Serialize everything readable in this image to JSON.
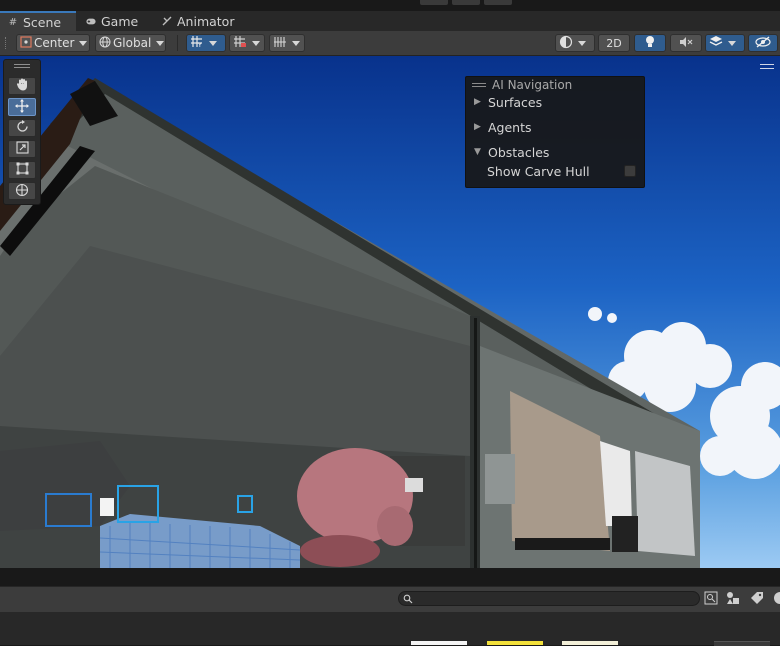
{
  "tabs": [
    {
      "label": "Scene",
      "icon": "hash-grid-icon"
    },
    {
      "label": "Game",
      "icon": "gamepad-icon"
    },
    {
      "label": "Animator",
      "icon": "animator-icon"
    }
  ],
  "toolbar": {
    "pivot_label": "Center",
    "space_label": "Global",
    "twod_label": "2D"
  },
  "ai_navigation": {
    "title": "AI Navigation",
    "items": [
      {
        "label": "Surfaces",
        "expanded": false
      },
      {
        "label": "Agents",
        "expanded": false
      },
      {
        "label": "Obstacles",
        "expanded": true
      }
    ],
    "show_carve_hull_label": "Show Carve Hull",
    "show_carve_hull_checked": false
  },
  "tools": [
    "hand-tool-icon",
    "move-tool-icon",
    "rotate-tool-icon",
    "scale-tool-icon",
    "rect-tool-icon",
    "transform-tool-icon"
  ],
  "selected_tool": "move-tool-icon",
  "colors": {
    "accent": "#3a79bb",
    "swatch_white": "#f4f4f4",
    "swatch_yellow": "#f2e03a",
    "swatch_cream": "#f3f0d9"
  }
}
